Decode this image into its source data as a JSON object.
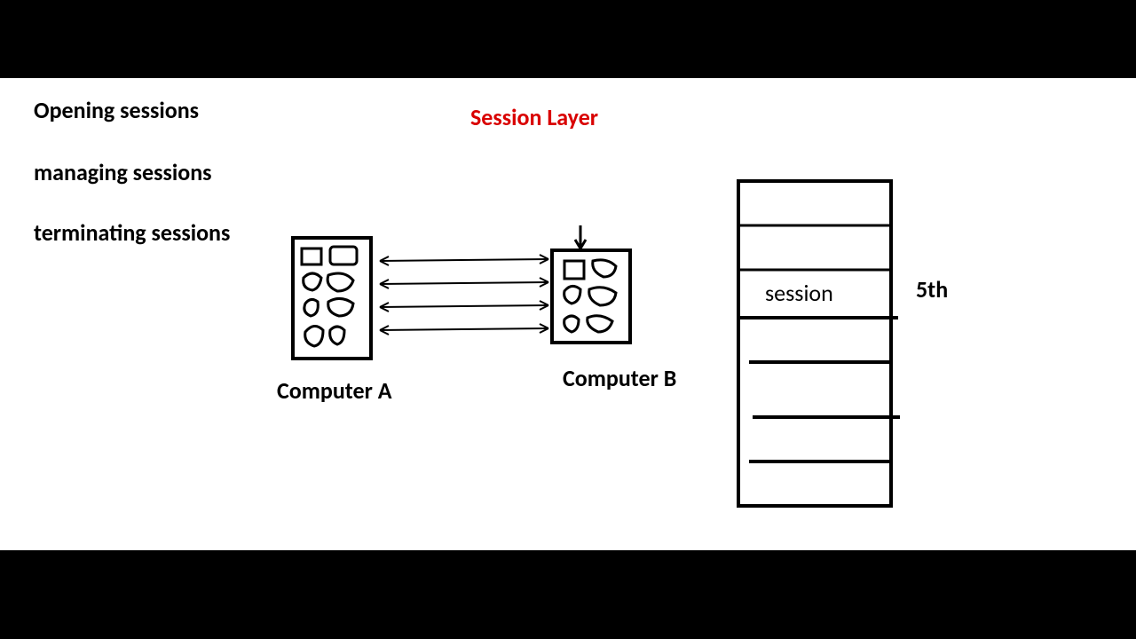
{
  "title": "Session Layer",
  "bullets": {
    "b1": "Opening sessions",
    "b2": "managing sessions",
    "b3": "terminating sessions"
  },
  "labels": {
    "computerA": "Computer A",
    "computerB": "Computer B",
    "session": "session",
    "fifth": "5th"
  },
  "diagram": {
    "concept": "Two computers (A and B) exchange data via bidirectional session arrows; a 7-layer stack on the right highlights the session layer as the 5th from top"
  }
}
